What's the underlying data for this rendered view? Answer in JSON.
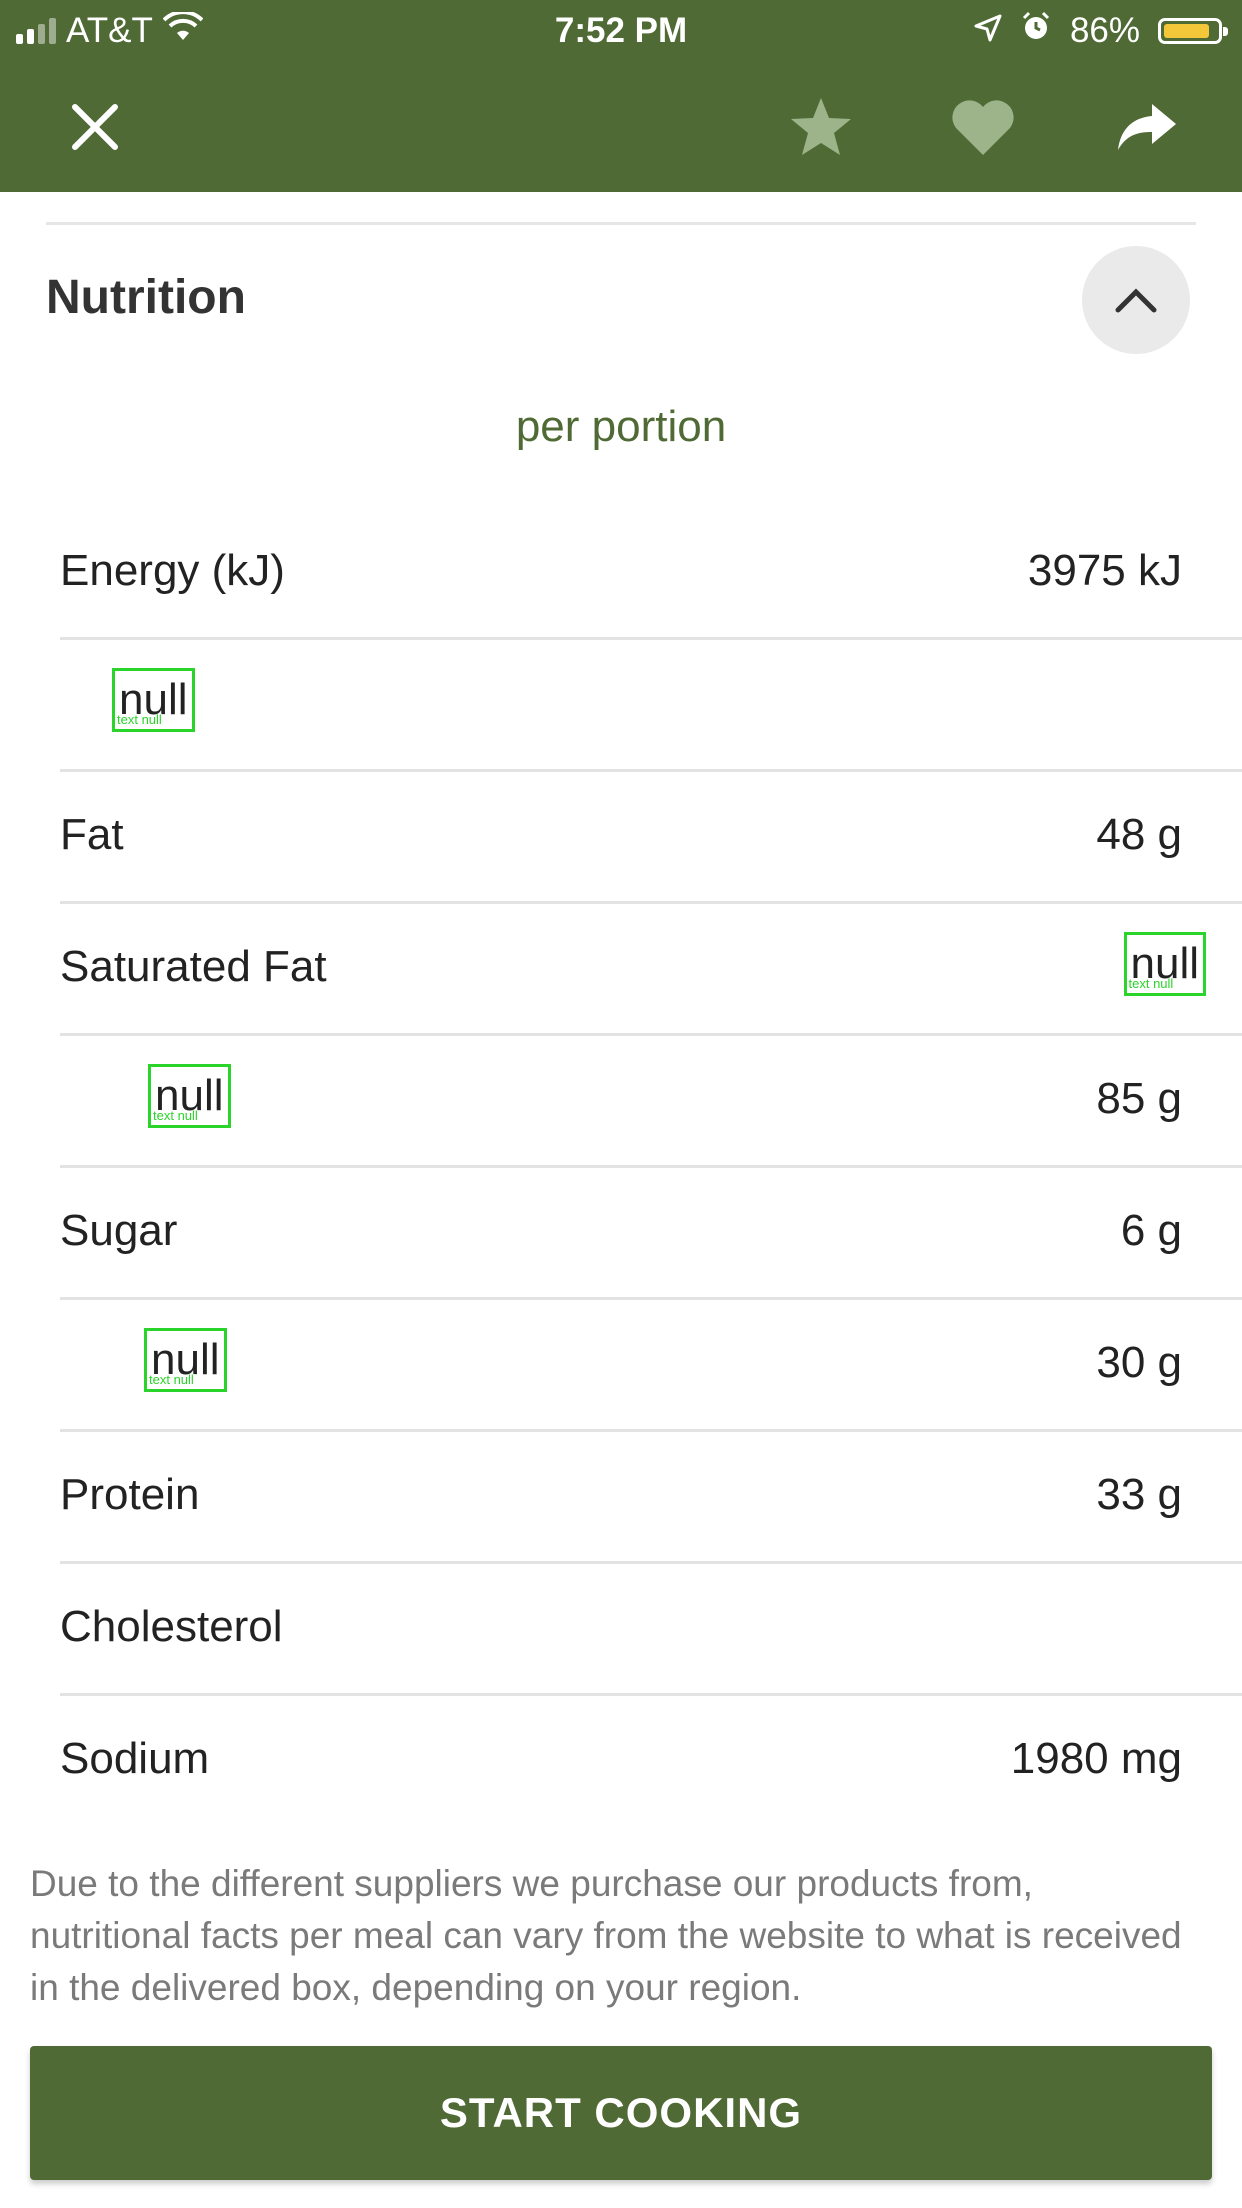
{
  "status_bar": {
    "carrier": "AT&T",
    "time": "7:52 PM",
    "battery": "86%",
    "battery_level": 0.86
  },
  "header": {
    "close_icon": "close-icon",
    "actions": [
      "star-icon",
      "heart-icon",
      "share-icon"
    ]
  },
  "section": {
    "title": "Nutrition",
    "subtitle": "per portion"
  },
  "rows": [
    {
      "label": "Energy (kJ)",
      "value": "3975 kJ"
    },
    {
      "label": "null",
      "value": ""
    },
    {
      "label": "Fat",
      "value": "48 g"
    },
    {
      "label": "Saturated Fat",
      "value": "null"
    },
    {
      "label": "null",
      "value": "85 g"
    },
    {
      "label": "Sugar",
      "value": "6 g"
    },
    {
      "label": "null",
      "value": "30 g"
    },
    {
      "label": "Protein",
      "value": "33 g"
    },
    {
      "label": "Cholesterol",
      "value": ""
    },
    {
      "label": "Sodium",
      "value": "1980 mg"
    }
  ],
  "null_note": "text null",
  "disclaimer": "Due to the different suppliers we purchase our products from, nutritional facts per meal can vary from the website to what is received in the delivered box, depending on your region.",
  "cta_label": "START COOKING",
  "colors": {
    "brand": "#4f6a34",
    "null_highlight": "#2ad42a",
    "battery": "#f4c73a"
  }
}
